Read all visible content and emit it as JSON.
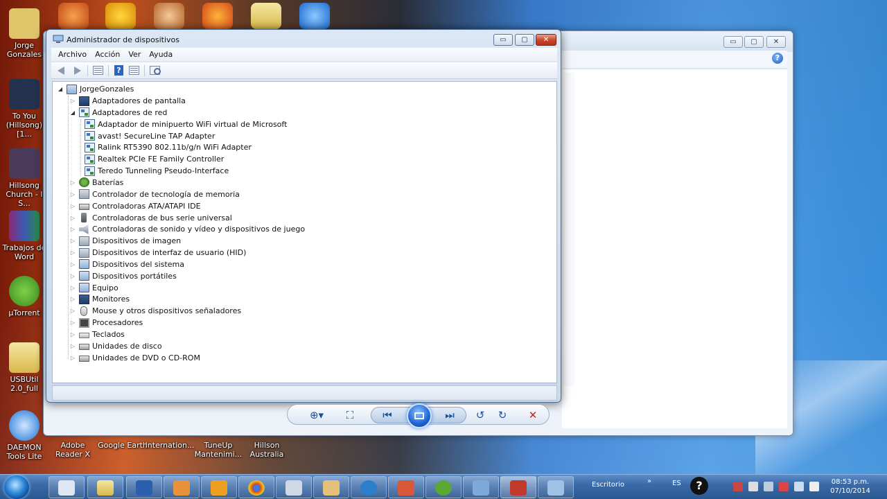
{
  "desktop": {
    "icons": [
      {
        "label": "Jorge\nGonzales",
        "color": "#e0c46a"
      },
      {
        "label": "To You\n(Hillsong)[1...",
        "color": "#24324f"
      },
      {
        "label": "Hillsong\nChurch - I S...",
        "color": "#4a3a5a"
      },
      {
        "label": "Trabajos de\nWord",
        "color": "#8a2a7a"
      },
      {
        "label": "µTorrent",
        "color": "#5aa832"
      },
      {
        "label": "USBUtil\n2.0_full",
        "color": "#e9c35a"
      },
      {
        "label": "DAEMON\nTools Lite",
        "color": "#1d74d6"
      },
      {
        "label": "Adobe\nReader X",
        "color": "#b41e1e"
      },
      {
        "label": "Google Earth",
        "color": "#2a6bd0"
      },
      {
        "label": "Internation...",
        "color": "#d9d9d9"
      },
      {
        "label": "TuneUp\nMantenimi...",
        "color": "#3a8ad8"
      },
      {
        "label": "Hillson\nAustralia",
        "color": "#e3c25a"
      }
    ]
  },
  "window": {
    "title": "Administrador de dispositivos",
    "buttons": {
      "minimize": "▭",
      "maximize": "▢",
      "close": "✕"
    },
    "menu": [
      "Archivo",
      "Acción",
      "Ver",
      "Ayuda"
    ],
    "toolbar_icons": [
      "back-icon",
      "forward-icon",
      "properties-icon",
      "help-icon",
      "view-icon",
      "scan-hardware-icon"
    ],
    "help_glyph": "?"
  },
  "tree": {
    "root": "JorgeGonzales",
    "items": [
      {
        "label": "Adaptadores de pantalla",
        "expander": "▷",
        "icon": "display",
        "level": 1
      },
      {
        "label": "Adaptadores de red",
        "expander": "◢",
        "icon": "net",
        "level": 1
      },
      {
        "label": "Adaptador de minipuerto WiFi virtual de Microsoft",
        "expander": "",
        "icon": "net",
        "level": 2
      },
      {
        "label": "avast! SecureLine TAP Adapter",
        "expander": "",
        "icon": "net",
        "level": 2
      },
      {
        "label": "Ralink RT5390 802.11b/g/n WiFi Adapter",
        "expander": "",
        "icon": "net",
        "level": 2
      },
      {
        "label": "Realtek PCIe FE Family Controller",
        "expander": "",
        "icon": "net",
        "level": 2
      },
      {
        "label": "Teredo Tunneling Pseudo-Interface",
        "expander": "",
        "icon": "net",
        "level": 2
      },
      {
        "label": "Baterías",
        "expander": "▷",
        "icon": "battery",
        "level": 1
      },
      {
        "label": "Controlador de tecnología de memoria",
        "expander": "▷",
        "icon": "generic",
        "level": 1
      },
      {
        "label": "Controladoras ATA/ATAPI IDE",
        "expander": "▷",
        "icon": "disk",
        "level": 1
      },
      {
        "label": "Controladoras de bus serie universal",
        "expander": "▷",
        "icon": "usb",
        "level": 1
      },
      {
        "label": "Controladoras de sonido y vídeo y dispositivos de juego",
        "expander": "▷",
        "icon": "sound",
        "level": 1
      },
      {
        "label": "Dispositivos de imagen",
        "expander": "▷",
        "icon": "generic",
        "level": 1
      },
      {
        "label": "Dispositivos de interfaz de usuario (HID)",
        "expander": "▷",
        "icon": "generic",
        "level": 1
      },
      {
        "label": "Dispositivos del sistema",
        "expander": "▷",
        "icon": "pc",
        "level": 1
      },
      {
        "label": "Dispositivos portátiles",
        "expander": "▷",
        "icon": "pc",
        "level": 1
      },
      {
        "label": "Equipo",
        "expander": "▷",
        "icon": "pc",
        "level": 1
      },
      {
        "label": "Monitores",
        "expander": "▷",
        "icon": "display",
        "level": 1
      },
      {
        "label": "Mouse y otros dispositivos señaladores",
        "expander": "▷",
        "icon": "mouse",
        "level": 1
      },
      {
        "label": "Procesadores",
        "expander": "▷",
        "icon": "cpu",
        "level": 1
      },
      {
        "label": "Teclados",
        "expander": "▷",
        "icon": "keyboard",
        "level": 1
      },
      {
        "label": "Unidades de disco",
        "expander": "▷",
        "icon": "disk",
        "level": 1
      },
      {
        "label": "Unidades de DVD o CD-ROM",
        "expander": "▷",
        "icon": "disk",
        "level": 1
      }
    ]
  },
  "viewer": {
    "zoom": "⊕▾",
    "fit": "⛶",
    "prev": "⏮",
    "next": "⏭",
    "rotate_ccw": "↺",
    "rotate_cw": "↻",
    "delete": "✕"
  },
  "taskbar": {
    "toolbar_label": "Escritorio",
    "language": "ES",
    "clock_time": "08:53 p.m.",
    "clock_date": "07/10/2014",
    "help_glyph": "?",
    "overflow_glyph": "»"
  }
}
